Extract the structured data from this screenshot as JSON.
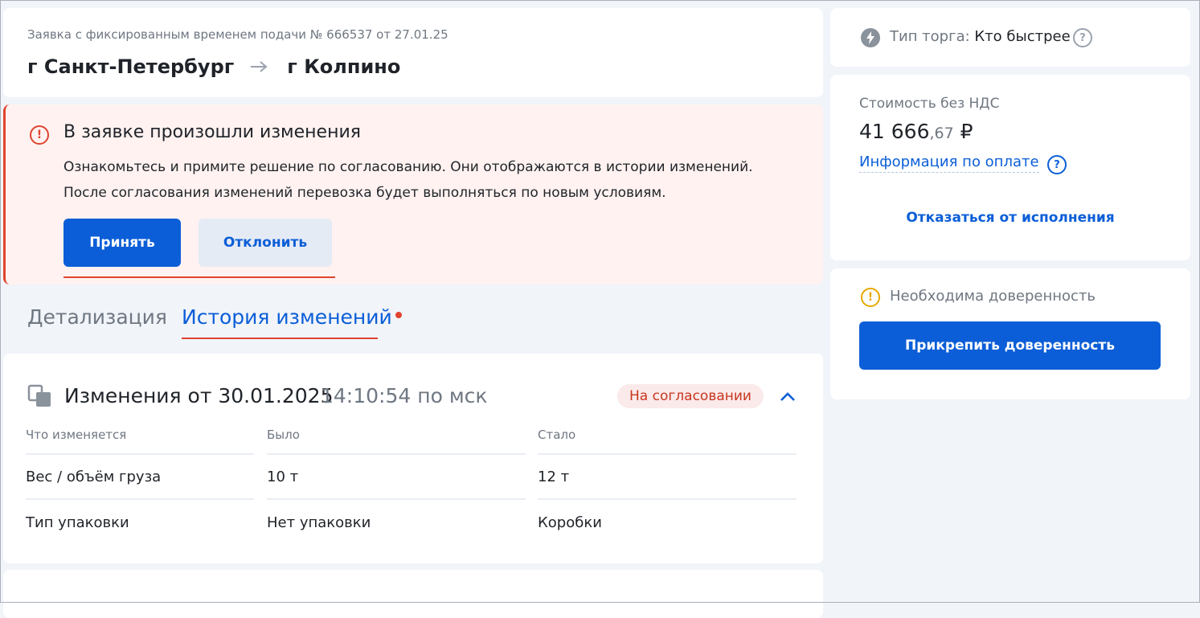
{
  "header": {
    "subtitle": "Заявка с фиксированным временем подачи № 666537 от 27.01.25",
    "from": "г Санкт-Петербург",
    "to": "г Колпино"
  },
  "alert": {
    "title": "В заявке произошли изменения",
    "line1": "Ознакомьтесь и примите решение по согласованию. Они отображаются в истории изменений.",
    "line2": "После согласования изменений перевозка будет выполняться по новым условиям.",
    "accept_label": "Принять",
    "decline_label": "Отклонить"
  },
  "tabs": {
    "details": "Детализация",
    "history": "История изменений"
  },
  "changes": {
    "title": "Изменения от 30.01.2025",
    "time": "14:10:54 по мск",
    "status": "На согласовании",
    "columns": [
      "Что изменяется",
      "Было",
      "Стало"
    ],
    "rows": [
      [
        "Вес / объём груза",
        "10 т",
        "12 т"
      ],
      [
        "Тип упаковки",
        "Нет упаковки",
        "Коробки"
      ]
    ]
  },
  "trade": {
    "label": "Тип торга:",
    "value": "Кто быстрее"
  },
  "price": {
    "label": "Стоимость без НДС",
    "value_main": "41 666",
    "value_cents": ",67",
    "currency": "₽",
    "info_link": "Информация по оплате",
    "refuse_link": "Отказаться от исполнения"
  },
  "power_of_attorney": {
    "notice": "Необходима доверенность",
    "button": "Прикрепить доверенность"
  },
  "colors": {
    "primary": "#0b5ed7",
    "alert_red": "#e0442f",
    "alert_bg": "#fff2f0",
    "warning": "#e8a800",
    "page_bg": "#f1f4f9"
  },
  "icons": {
    "alert": "exclamation-circle-icon",
    "arrow": "arrow-right-icon",
    "changes": "documents-icon",
    "collapse": "chevron-up-icon",
    "trade": "lightning-icon",
    "help": "question-circle-icon",
    "warning": "exclamation-circle-icon"
  }
}
